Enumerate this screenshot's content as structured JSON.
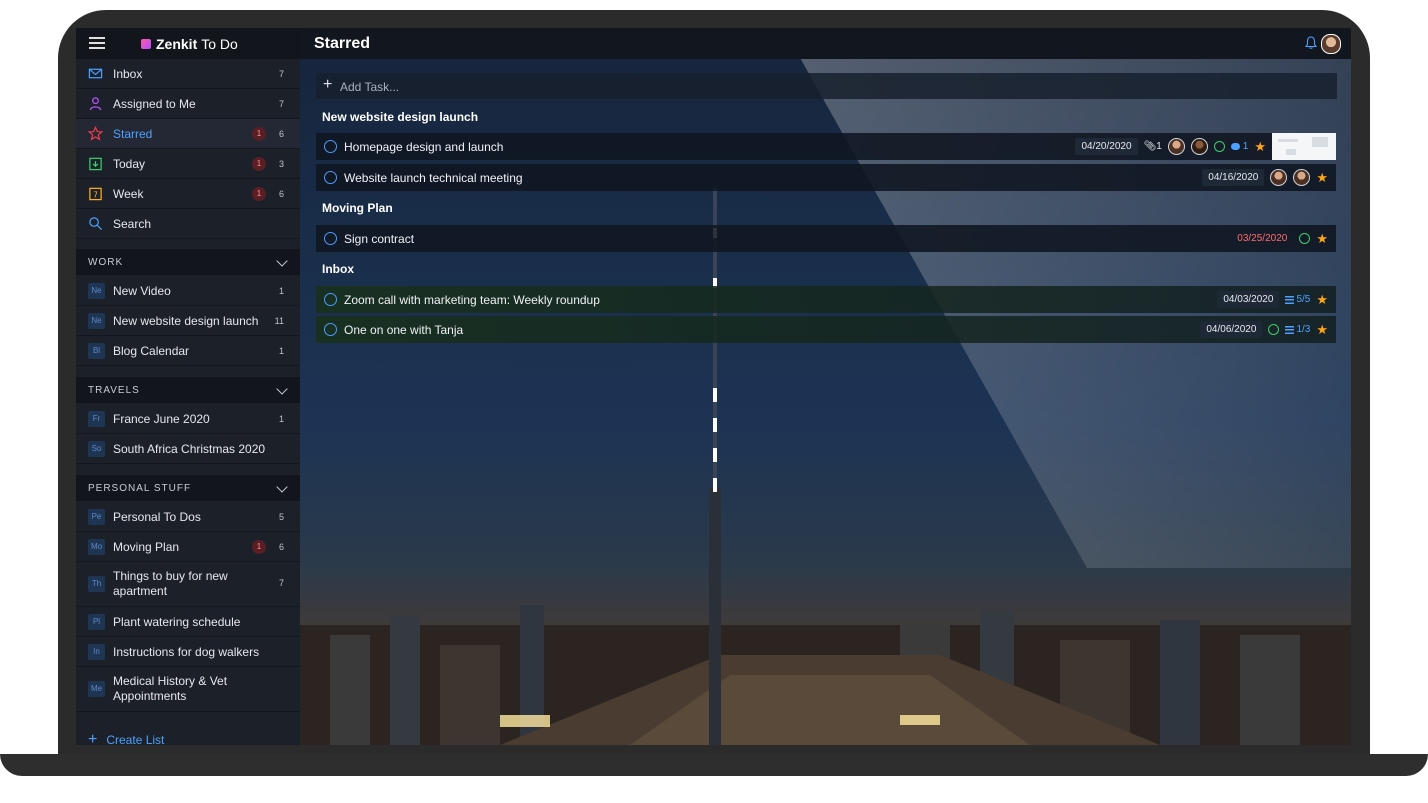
{
  "app": {
    "brand": "Zenkit",
    "product": "To Do"
  },
  "nav": [
    {
      "label": "Inbox",
      "count": "7",
      "badge": "",
      "icon": "inbox-icon",
      "color": "#4ea1ff"
    },
    {
      "label": "Assigned to Me",
      "count": "7",
      "badge": "",
      "icon": "user-icon",
      "color": "#b655ff"
    },
    {
      "label": "Starred",
      "count": "6",
      "badge": "1",
      "icon": "star-icon",
      "color": "#ff3b4f"
    },
    {
      "label": "Today",
      "count": "3",
      "badge": "1",
      "icon": "today-calendar-icon",
      "color": "#3ccf6a"
    },
    {
      "label": "Week",
      "count": "6",
      "badge": "1",
      "icon": "week-calendar-icon",
      "color": "#ffb020"
    },
    {
      "label": "Search",
      "count": "",
      "badge": "",
      "icon": "search-icon",
      "color": "#4ea1ff"
    }
  ],
  "sections": [
    {
      "title": "WORK",
      "items": [
        {
          "abbr": "Ne",
          "label": "New Video",
          "count": "1",
          "badge": ""
        },
        {
          "abbr": "Ne",
          "label": "New website design launch",
          "count": "11",
          "badge": ""
        },
        {
          "abbr": "Bl",
          "label": "Blog Calendar",
          "count": "1",
          "badge": ""
        }
      ]
    },
    {
      "title": "TRAVELS",
      "items": [
        {
          "abbr": "Fr",
          "label": "France June 2020",
          "count": "1",
          "badge": ""
        },
        {
          "abbr": "So",
          "label": "South Africa Christmas 2020",
          "count": "",
          "badge": ""
        }
      ]
    },
    {
      "title": "PERSONAL STUFF",
      "items": [
        {
          "abbr": "Pe",
          "label": "Personal To Dos",
          "count": "5",
          "badge": ""
        },
        {
          "abbr": "Mo",
          "label": "Moving Plan",
          "count": "6",
          "badge": "1"
        },
        {
          "abbr": "Th",
          "label": "Things to buy for new apartment",
          "count": "7",
          "badge": ""
        },
        {
          "abbr": "Pl",
          "label": "Plant watering schedule",
          "count": "",
          "badge": ""
        },
        {
          "abbr": "In",
          "label": "Instructions for dog walkers",
          "count": "",
          "badge": ""
        },
        {
          "abbr": "Me",
          "label": "Medical History & Vet Appointments",
          "count": "",
          "badge": ""
        }
      ]
    }
  ],
  "create_list": "Create List",
  "main": {
    "title": "Starred",
    "add_task_placeholder": "Add Task...",
    "groups": [
      {
        "title": "New website design launch"
      },
      {
        "title": "Moving Plan"
      },
      {
        "title": "Inbox"
      }
    ],
    "tasks": [
      {
        "title": "Homepage design and launch",
        "date": "04/20/2020",
        "attachments": "1",
        "comments": "1"
      },
      {
        "title": "Website launch technical meeting",
        "date": "04/16/2020"
      },
      {
        "title": "Sign contract",
        "date": "03/25/2020"
      },
      {
        "title": "Zoom call with marketing team: Weekly roundup",
        "date": "04/03/2020",
        "checklist": "5/5"
      },
      {
        "title": "One on one with Tanja",
        "date": "04/06/2020",
        "checklist": "1/3"
      }
    ]
  },
  "colors": {
    "accent": "#4ea1ff",
    "star": "#ffa31a",
    "overdue": "#ff6b6b",
    "alarm": "#3ccf6a"
  }
}
